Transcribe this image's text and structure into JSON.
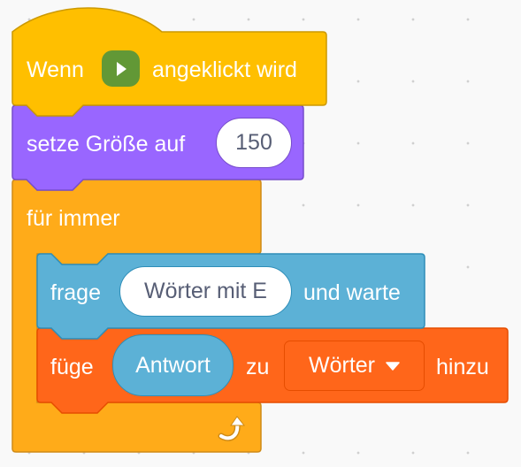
{
  "script": {
    "hat": {
      "label_before": "Wenn",
      "icon": "green-flag-icon",
      "label_after": "angeklickt wird",
      "color": "#FFBF00"
    },
    "set_size": {
      "label": "setze Größe auf",
      "value": "150",
      "color": "#9966FF"
    },
    "forever": {
      "label": "für immer",
      "icon": "loop-arrow-icon",
      "color": "#FFAB19"
    },
    "ask": {
      "label": "frage",
      "value": "Wörter mit E",
      "label_after": "und warte",
      "color": "#5CB1D6"
    },
    "add_to_list": {
      "label": "füge",
      "reporter": "Antwort",
      "label_mid": "zu",
      "list": "Wörter",
      "label_after": "hinzu",
      "color": "#FF661A"
    }
  }
}
